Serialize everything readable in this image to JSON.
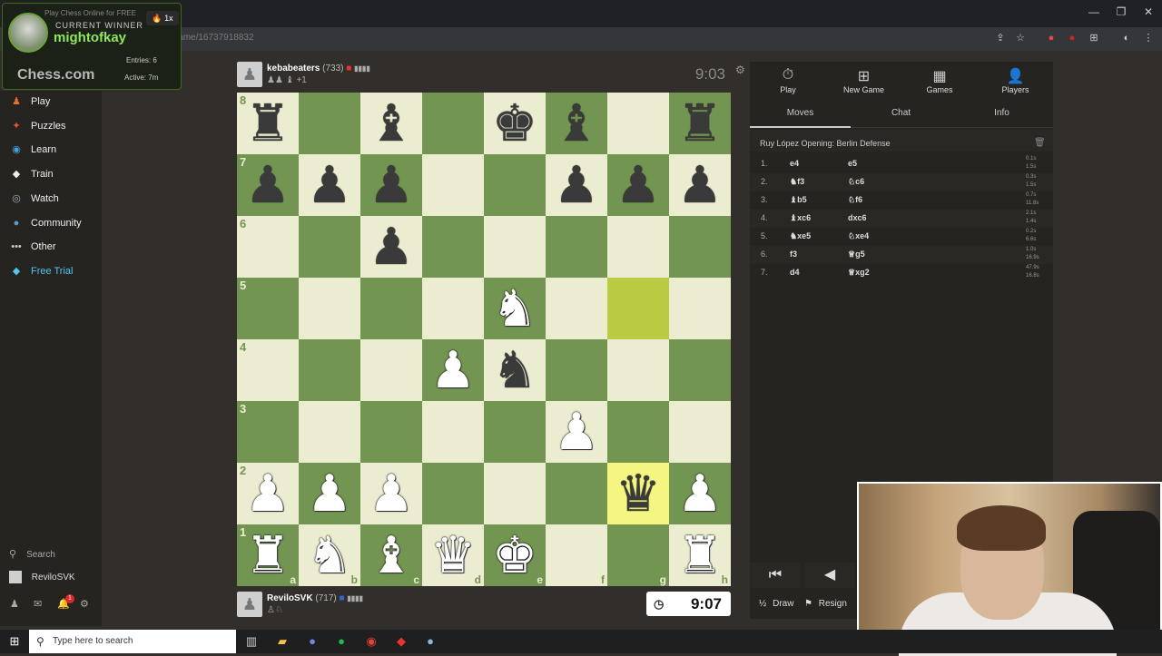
{
  "browser": {
    "url": "chess.com/game/16737918832",
    "window_controls": [
      "—",
      "❐",
      "✕"
    ],
    "toolbar_icons": [
      "⇪",
      "☆",
      "●",
      "●",
      "⊞",
      "◐",
      "⋮"
    ]
  },
  "overlay": {
    "promo": "Play Chess Online for FREE",
    "label": "CURRENT WINNER",
    "winner": "mightofkay",
    "badge": "🔥 1x",
    "logo": "Chess.com",
    "entries": "Entries: 6",
    "active": "Active: 7m"
  },
  "sidebar": {
    "items": [
      {
        "label": "Play",
        "icon": "♟",
        "color": "#e76e2b"
      },
      {
        "label": "Puzzles",
        "icon": "✦",
        "color": "#e4572e"
      },
      {
        "label": "Learn",
        "icon": "◉",
        "color": "#3fa1d7"
      },
      {
        "label": "Train",
        "icon": "◆",
        "color": "#eee"
      },
      {
        "label": "Watch",
        "icon": "◎",
        "color": "#9ab"
      },
      {
        "label": "Community",
        "icon": "●",
        "color": "#5b9bd5"
      },
      {
        "label": "Other",
        "icon": "•••",
        "color": "#ccc"
      },
      {
        "label": "Free Trial",
        "icon": "◆",
        "color": "#54c6eb"
      }
    ],
    "search": "Search",
    "user": "ReviloSVK",
    "notification_count": "1"
  },
  "top_player": {
    "name": "kebabeaters",
    "rating": "(733)",
    "captured": "♟♟ ♝ +1",
    "clock": "9:03"
  },
  "bottom_player": {
    "name": "ReviloSVK",
    "rating": "(717)",
    "captured": "♙♘",
    "clock": "9:07"
  },
  "board": {
    "ranks": [
      "8",
      "7",
      "6",
      "5",
      "4",
      "3",
      "2",
      "1"
    ],
    "files": [
      "a",
      "b",
      "c",
      "d",
      "e",
      "f",
      "g",
      "h"
    ],
    "position": [
      [
        "bR",
        "",
        "bB",
        "",
        "bK",
        "bB",
        "",
        "bR"
      ],
      [
        "bP",
        "bP",
        "bP",
        "",
        "",
        "bP",
        "bP",
        "bP"
      ],
      [
        "",
        "",
        "bP",
        "",
        "",
        "",
        "",
        ""
      ],
      [
        "",
        "",
        "",
        "",
        "wN",
        "",
        "",
        ""
      ],
      [
        "",
        "",
        "",
        "wP",
        "bN",
        "",
        "",
        ""
      ],
      [
        "",
        "",
        "",
        "",
        "",
        "wP",
        "",
        ""
      ],
      [
        "wP",
        "wP",
        "wP",
        "",
        "",
        "",
        "bQ",
        "wP"
      ],
      [
        "wR",
        "wN",
        "wB",
        "wQ",
        "wK",
        "",
        "",
        "wR"
      ]
    ],
    "highlights": [
      "g5",
      "g2"
    ],
    "colors": {
      "light": "#ebecd0",
      "dark": "#739552"
    }
  },
  "panel": {
    "tabs": [
      {
        "label": "Play",
        "icon": "⏱"
      },
      {
        "label": "New Game",
        "icon": "⊞"
      },
      {
        "label": "Games",
        "icon": "▦"
      },
      {
        "label": "Players",
        "icon": "👤"
      }
    ],
    "subtabs": [
      "Moves",
      "Chat",
      "Info"
    ],
    "opening": "Ruy López Opening: Berlin Defense",
    "moves": [
      {
        "n": "1.",
        "w": "e4",
        "b": "e5",
        "tw": "0.1s",
        "tb": "1.5s"
      },
      {
        "n": "2.",
        "w": "♞f3",
        "b": "♘c6",
        "tw": "0.3s",
        "tb": "1.5s"
      },
      {
        "n": "3.",
        "w": "♝b5",
        "b": "♘f6",
        "tw": "0.7s",
        "tb": "11.8s"
      },
      {
        "n": "4.",
        "w": "♝xc6",
        "b": "dxc6",
        "tw": "2.1s",
        "tb": "1.4s"
      },
      {
        "n": "5.",
        "w": "♞xe5",
        "b": "♘xe4",
        "tw": "0.2s",
        "tb": "6.6s"
      },
      {
        "n": "6.",
        "w": "f3",
        "b": "♕g5",
        "tw": "1.0s",
        "tb": "16.9s"
      },
      {
        "n": "7.",
        "w": "d4",
        "b": "♕xg2",
        "tw": "47.9s",
        "tb": "16.8s"
      }
    ],
    "draw": "Draw",
    "resign": "Resign"
  },
  "taskbar": {
    "search_placeholder": "Type here to search"
  }
}
